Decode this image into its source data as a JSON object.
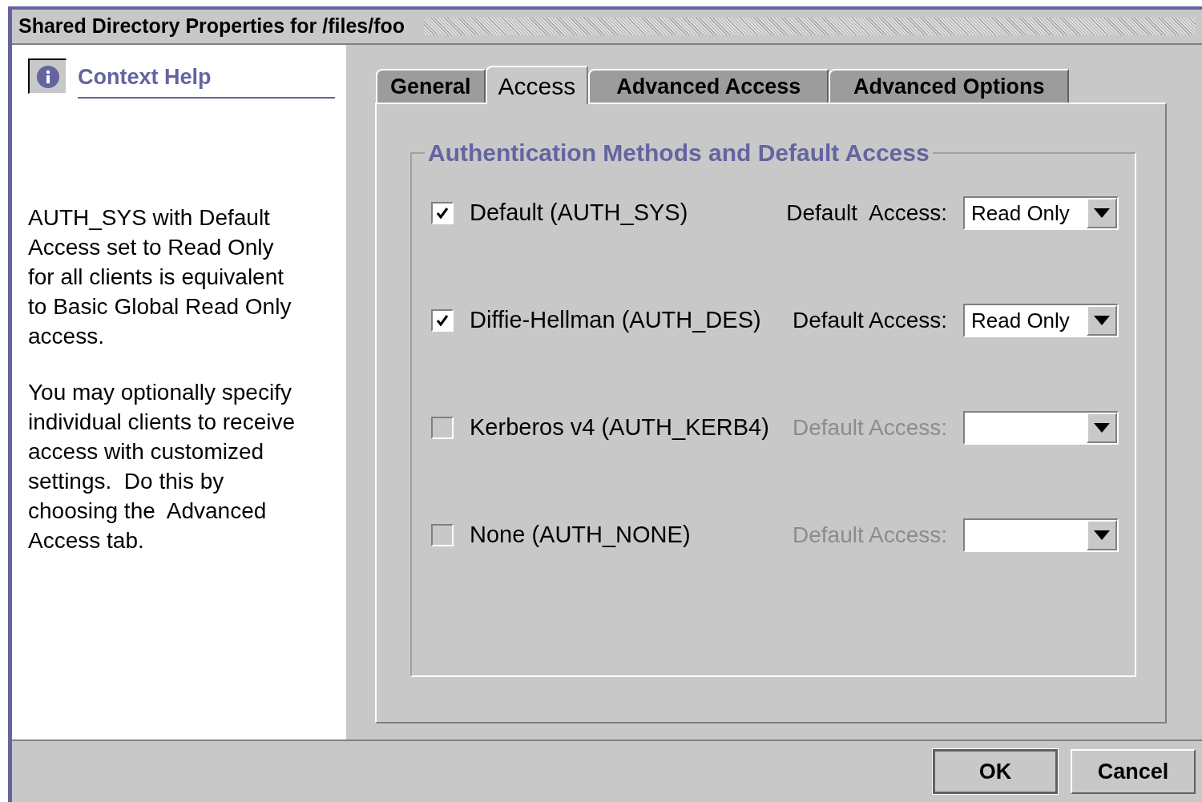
{
  "window": {
    "title": "Shared Directory Properties for /files/foo"
  },
  "context_help": {
    "label": "Context Help",
    "paragraphs": [
      "AUTH_SYS with Default Access set to Read Only for all clients is equivalent to Basic Global Read Only access.",
      "You may optionally specify individual clients to receive access with customized settings.  Do this by choosing the  Advanced Access tab."
    ]
  },
  "tabs": [
    {
      "label": "General",
      "selected": false
    },
    {
      "label": "Access",
      "selected": true
    },
    {
      "label": "Advanced Access",
      "selected": false
    },
    {
      "label": "Advanced Options",
      "selected": false
    }
  ],
  "group": {
    "title": "Authentication Methods and Default Access",
    "methods": [
      {
        "label": "Default (AUTH_SYS)",
        "checked": true,
        "disabled": false,
        "access_label": "Default  Access:",
        "access_value": "Read Only"
      },
      {
        "label": "Diffie-Hellman (AUTH_DES)",
        "checked": true,
        "disabled": false,
        "access_label": "Default Access:",
        "access_value": "Read Only"
      },
      {
        "label": "Kerberos v4 (AUTH_KERB4)",
        "checked": false,
        "disabled": true,
        "access_label": "Default Access:"
      },
      {
        "label": "None (AUTH_NONE)",
        "checked": false,
        "disabled": true,
        "access_label": "Default Access:"
      }
    ]
  },
  "buttons": [
    {
      "label": "OK",
      "default": true
    },
    {
      "label": "Cancel",
      "default": false
    }
  ]
}
